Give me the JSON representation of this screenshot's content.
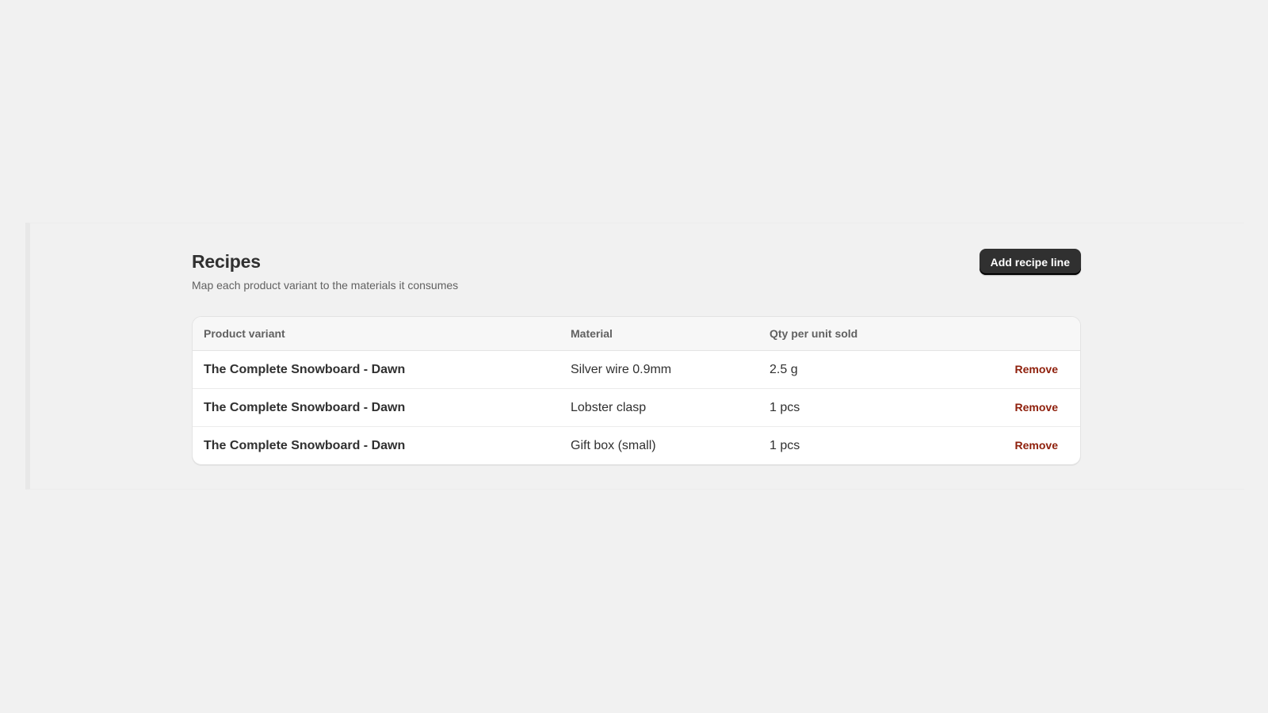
{
  "page": {
    "title": "Recipes",
    "subtitle": "Map each product variant to the materials it consumes",
    "add_button_label": "Add recipe line"
  },
  "table": {
    "columns": [
      "Product variant",
      "Material",
      "Qty per unit sold",
      ""
    ],
    "rows": [
      {
        "variant": "The Complete Snowboard - Dawn",
        "material": "Silver wire 0.9mm",
        "qty": "2.5 g",
        "action": "Remove"
      },
      {
        "variant": "The Complete Snowboard - Dawn",
        "material": "Lobster clasp",
        "qty": "1 pcs",
        "action": "Remove"
      },
      {
        "variant": "The Complete Snowboard - Dawn",
        "material": "Gift box (small)",
        "qty": "1 pcs",
        "action": "Remove"
      }
    ]
  },
  "colors": {
    "background": "#f1f1f1",
    "primary_button": "#303030",
    "critical_text": "#8e1f0b"
  }
}
